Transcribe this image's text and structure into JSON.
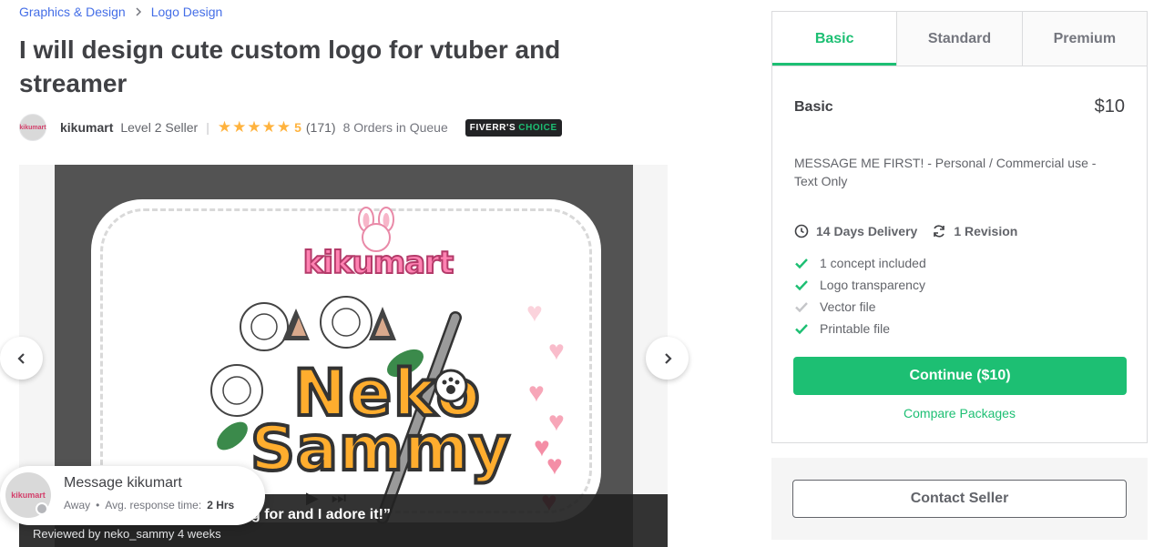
{
  "breadcrumb": {
    "items": [
      "Graphics & Design",
      "Logo Design"
    ],
    "separator_icon": "chevron-right-icon"
  },
  "gig": {
    "title": "I will design cute custom logo for vtuber and streamer"
  },
  "seller": {
    "avatar_text": "kikumart",
    "name": "kikumart",
    "level": "Level 2 Seller",
    "divider": "|",
    "rating_value": "5",
    "stars": 5,
    "reviews": "(171)",
    "queue": "8 Orders in Queue",
    "badge_prefix": "FIVERR'S",
    "badge_accent": "CHOICE"
  },
  "gallery": {
    "artwork_brand": "kikumart",
    "artwork_line1": "Neko",
    "artwork_line2": "Sammy",
    "review_quote": "g for and I adore it!”",
    "review_meta": "Reviewed by neko_sammy 4 weeks",
    "prev_icon": "chevron-left-icon",
    "next_icon": "chevron-right-icon"
  },
  "message": {
    "avatar_text": "kikumart",
    "title": "Message kikumart",
    "status": "Away",
    "bullet": "•",
    "response_label": "Avg. response time:",
    "response_value": "2 Hrs"
  },
  "packages": {
    "tabs": [
      "Basic",
      "Standard",
      "Premium"
    ],
    "active_tab": "Basic",
    "name": "Basic",
    "price": "$10",
    "description": "MESSAGE ME FIRST! - Personal / Commercial use - Text Only",
    "delivery": "14 Days Delivery",
    "revisions": "1 Revision",
    "features": [
      {
        "label": "1 concept included",
        "included": true
      },
      {
        "label": "Logo transparency",
        "included": true
      },
      {
        "label": "Vector file",
        "included": false
      },
      {
        "label": "Printable file",
        "included": true
      }
    ],
    "continue_label": "Continue ($10)",
    "compare_label": "Compare Packages"
  },
  "contact": {
    "button_label": "Contact Seller"
  },
  "colors": {
    "accent": "#1dbf73",
    "link": "#446ee7",
    "star": "#ffb33e",
    "check_included": "#1dbf73",
    "check_excluded": "#c5c6c9"
  }
}
